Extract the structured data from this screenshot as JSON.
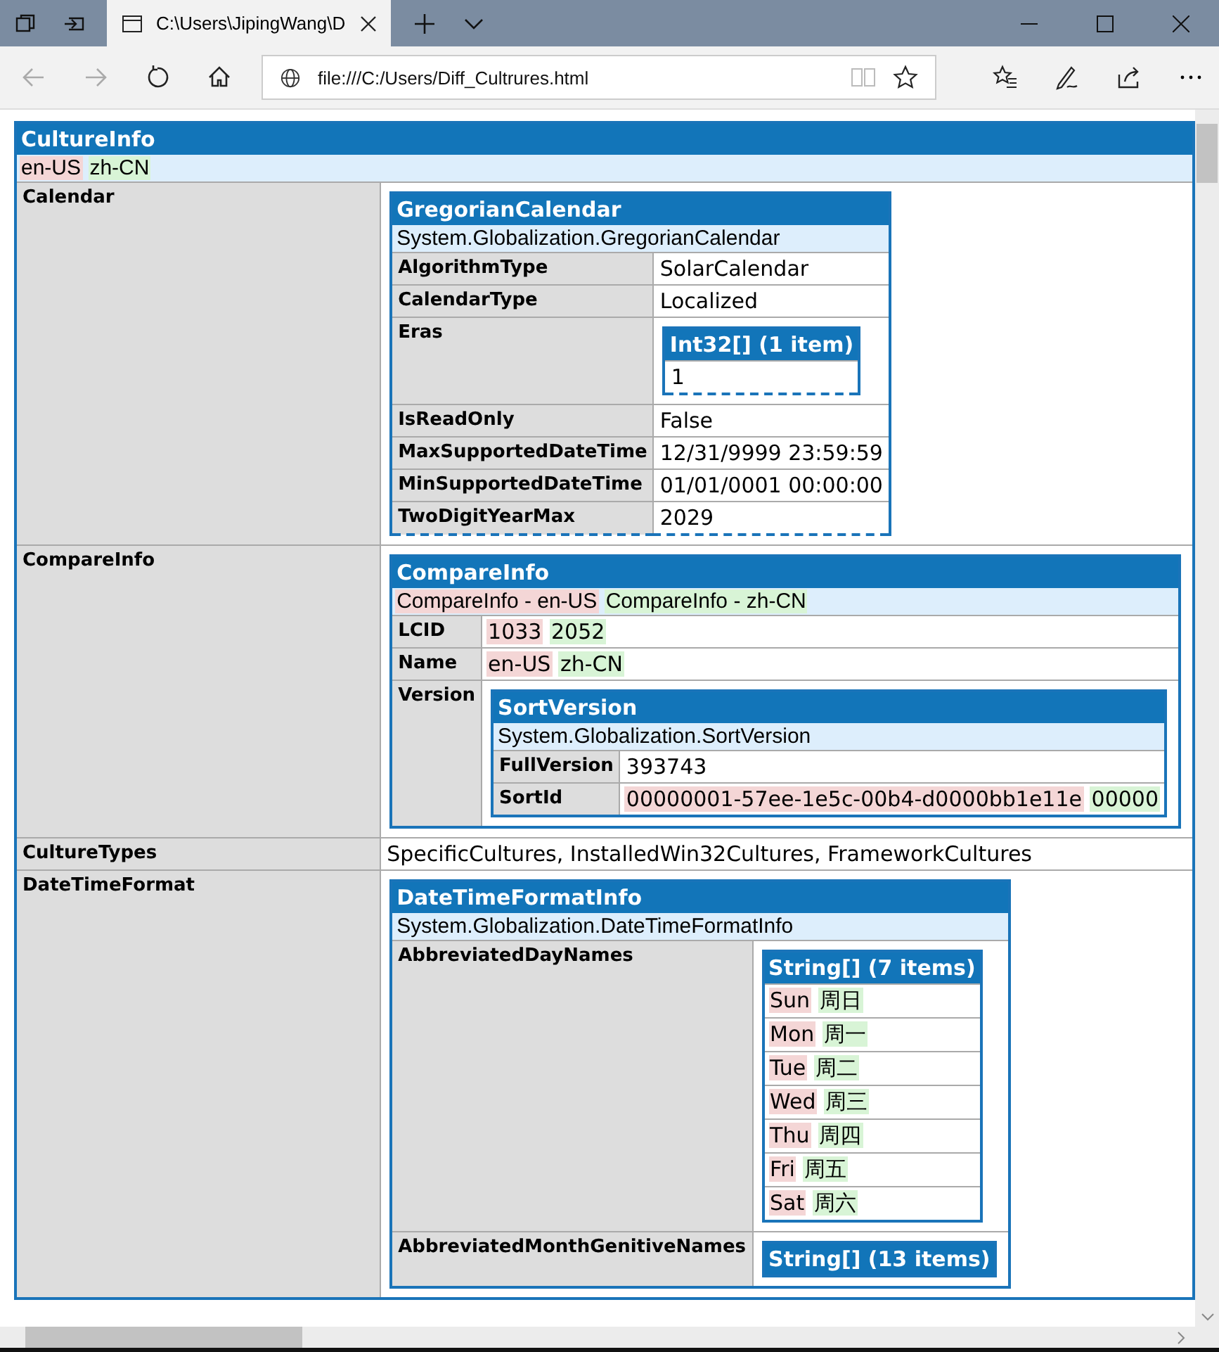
{
  "browser": {
    "tab_title": "C:\\Users\\JipingWang\\D",
    "url": "file:///C:/Users/Diff_Cultrures.html"
  },
  "dump": {
    "kind": "object",
    "title": "CultureInfo",
    "dashed": false,
    "subtitle": [
      {
        "text": "en-US",
        "color": "#f4d6d6"
      },
      {
        "text": "zh-CN",
        "color": "#d8f4d6"
      }
    ],
    "rows": [
      {
        "label": "Calendar",
        "value": {
          "kind": "object",
          "title": "GregorianCalendar",
          "dashed": true,
          "subtitle": [
            {
              "text": "System.Globalization.GregorianCalendar"
            }
          ],
          "rows": [
            {
              "label": "AlgorithmType",
              "value": {
                "kind": "text",
                "parts": [
                  {
                    "text": "SolarCalendar"
                  }
                ]
              }
            },
            {
              "label": "CalendarType",
              "value": {
                "kind": "text",
                "parts": [
                  {
                    "text": "Localized"
                  }
                ]
              }
            },
            {
              "label": "Eras",
              "value": {
                "kind": "list",
                "title": "Int32[] (1 item)",
                "dashed": true,
                "items": [
                  [
                    {
                      "text": "1"
                    }
                  ]
                ]
              }
            },
            {
              "label": "IsReadOnly",
              "value": {
                "kind": "text",
                "parts": [
                  {
                    "text": "False"
                  }
                ]
              }
            },
            {
              "label": "MaxSupportedDateTime",
              "value": {
                "kind": "text",
                "parts": [
                  {
                    "text": "12/31/9999 23:59:59"
                  }
                ]
              }
            },
            {
              "label": "MinSupportedDateTime",
              "value": {
                "kind": "text",
                "parts": [
                  {
                    "text": "01/01/0001 00:00:00"
                  }
                ]
              }
            },
            {
              "label": "TwoDigitYearMax",
              "value": {
                "kind": "text",
                "parts": [
                  {
                    "text": "2029"
                  }
                ]
              }
            }
          ]
        }
      },
      {
        "label": "CompareInfo",
        "value": {
          "kind": "object",
          "title": "CompareInfo",
          "dashed": false,
          "subtitle": [
            {
              "text": "CompareInfo - en-US",
              "color": "#f4d6d6"
            },
            {
              "text": "CompareInfo - zh-CN",
              "color": "#d8f4d6"
            }
          ],
          "rows": [
            {
              "label": "LCID",
              "value": {
                "kind": "text",
                "parts": [
                  {
                    "text": "1033",
                    "color": "#f4d6d6"
                  },
                  {
                    "text": "2052",
                    "color": "#d8f4d6"
                  }
                ]
              }
            },
            {
              "label": "Name",
              "value": {
                "kind": "text",
                "parts": [
                  {
                    "text": "en-US",
                    "color": "#f4d6d6"
                  },
                  {
                    "text": "zh-CN",
                    "color": "#d8f4d6"
                  }
                ]
              }
            },
            {
              "label": "Version",
              "value": {
                "kind": "object",
                "title": "SortVersion",
                "dashed": false,
                "subtitle": [
                  {
                    "text": "System.Globalization.SortVersion"
                  }
                ],
                "rows": [
                  {
                    "label": "FullVersion",
                    "value": {
                      "kind": "text",
                      "parts": [
                        {
                          "text": "393743"
                        }
                      ]
                    }
                  },
                  {
                    "label": "SortId",
                    "value": {
                      "kind": "text",
                      "parts": [
                        {
                          "text": "00000001-57ee-1e5c-00b4-d0000bb1e11e",
                          "color": "#f4d6d6"
                        },
                        {
                          "text": "00000",
                          "color": "#d8f4d6"
                        }
                      ]
                    }
                  }
                ]
              }
            }
          ]
        }
      },
      {
        "label": "CultureTypes",
        "value": {
          "kind": "text",
          "parts": [
            {
              "text": "SpecificCultures, InstalledWin32Cultures, FrameworkCultures"
            }
          ]
        }
      },
      {
        "label": "DateTimeFormat",
        "value": {
          "kind": "object",
          "title": "DateTimeFormatInfo",
          "dashed": false,
          "subtitle": [
            {
              "text": "System.Globalization.DateTimeFormatInfo"
            }
          ],
          "rows": [
            {
              "label": "AbbreviatedDayNames",
              "value": {
                "kind": "list",
                "title": "String[] (7 items)",
                "dashed": false,
                "items": [
                  [
                    {
                      "text": "Sun",
                      "color": "#f4d6d6"
                    },
                    {
                      "text": "周日",
                      "color": "#d8f4d6"
                    }
                  ],
                  [
                    {
                      "text": "Mon",
                      "color": "#f4d6d6"
                    },
                    {
                      "text": "周一",
                      "color": "#d8f4d6"
                    }
                  ],
                  [
                    {
                      "text": "Tue",
                      "color": "#f4d6d6"
                    },
                    {
                      "text": "周二",
                      "color": "#d8f4d6"
                    }
                  ],
                  [
                    {
                      "text": "Wed",
                      "color": "#f4d6d6"
                    },
                    {
                      "text": "周三",
                      "color": "#d8f4d6"
                    }
                  ],
                  [
                    {
                      "text": "Thu",
                      "color": "#f4d6d6"
                    },
                    {
                      "text": "周四",
                      "color": "#d8f4d6"
                    }
                  ],
                  [
                    {
                      "text": "Fri",
                      "color": "#f4d6d6"
                    },
                    {
                      "text": "周五",
                      "color": "#d8f4d6"
                    }
                  ],
                  [
                    {
                      "text": "Sat",
                      "color": "#f4d6d6"
                    },
                    {
                      "text": "周六",
                      "color": "#d8f4d6"
                    }
                  ]
                ]
              }
            },
            {
              "label": "AbbreviatedMonthGenitiveNames",
              "value": {
                "kind": "list",
                "title": "String[] (13 items)",
                "dashed": false
              }
            }
          ]
        }
      }
    ]
  }
}
